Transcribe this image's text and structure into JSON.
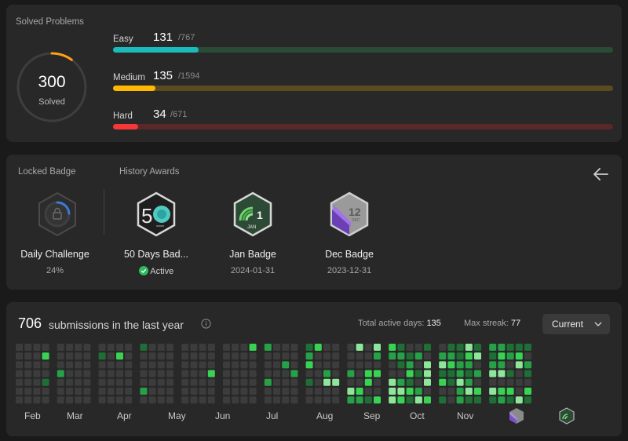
{
  "solved": {
    "title": "Solved Problems",
    "total": "300",
    "total_label": "Solved",
    "ring_fraction": 0.1,
    "ring_color": "#ffa116",
    "rows": [
      {
        "label": "Easy",
        "count": "131",
        "total": "/767",
        "fraction": 0.1708,
        "color": "#1cbaba",
        "track": "#2a4b36"
      },
      {
        "label": "Medium",
        "count": "135",
        "total": "/1594",
        "fraction": 0.0847,
        "color": "#ffb700",
        "track": "#5a4a1e"
      },
      {
        "label": "Hard",
        "count": "34",
        "total": "/671",
        "fraction": 0.0507,
        "color": "#f63737",
        "track": "#5a2828"
      }
    ]
  },
  "badges": {
    "locked_title": "Locked Badge",
    "history_title": "History Awards",
    "locked": {
      "name": "Daily Challenge",
      "sub": "24%",
      "progress": 0.24
    },
    "awards": [
      {
        "name": "50 Days Bad...",
        "sub": "Active"
      },
      {
        "name": "Jan Badge",
        "sub": "2024-01-31"
      },
      {
        "name": "Dec Badge",
        "sub": "2023-12-31"
      }
    ]
  },
  "submissions": {
    "count": "706",
    "text": "submissions in the last year",
    "active_days_label": "Total active days:",
    "active_days": "135",
    "max_streak_label": "Max streak:",
    "max_streak": "77",
    "dropdown": "Current",
    "months": [
      "Feb",
      "Mar",
      "Apr",
      "May",
      "Jun",
      "Jul",
      "Aug",
      "Sep",
      "Oct",
      "Nov"
    ]
  }
}
